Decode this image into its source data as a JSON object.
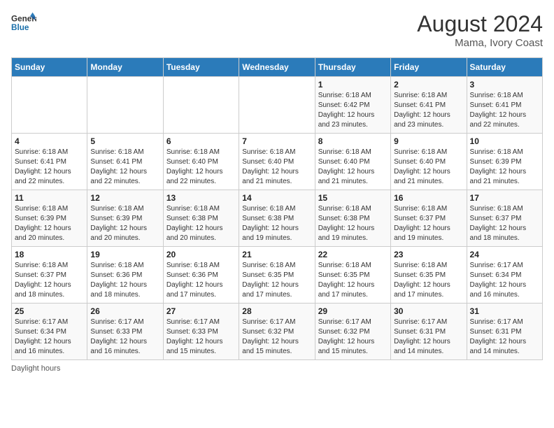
{
  "header": {
    "logo_general": "General",
    "logo_blue": "Blue",
    "month_year": "August 2024",
    "location": "Mama, Ivory Coast"
  },
  "days_of_week": [
    "Sunday",
    "Monday",
    "Tuesday",
    "Wednesday",
    "Thursday",
    "Friday",
    "Saturday"
  ],
  "weeks": [
    [
      {
        "day": "",
        "info": ""
      },
      {
        "day": "",
        "info": ""
      },
      {
        "day": "",
        "info": ""
      },
      {
        "day": "",
        "info": ""
      },
      {
        "day": "1",
        "info": "Sunrise: 6:18 AM\nSunset: 6:42 PM\nDaylight: 12 hours\nand 23 minutes."
      },
      {
        "day": "2",
        "info": "Sunrise: 6:18 AM\nSunset: 6:41 PM\nDaylight: 12 hours\nand 23 minutes."
      },
      {
        "day": "3",
        "info": "Sunrise: 6:18 AM\nSunset: 6:41 PM\nDaylight: 12 hours\nand 22 minutes."
      }
    ],
    [
      {
        "day": "4",
        "info": "Sunrise: 6:18 AM\nSunset: 6:41 PM\nDaylight: 12 hours\nand 22 minutes."
      },
      {
        "day": "5",
        "info": "Sunrise: 6:18 AM\nSunset: 6:41 PM\nDaylight: 12 hours\nand 22 minutes."
      },
      {
        "day": "6",
        "info": "Sunrise: 6:18 AM\nSunset: 6:40 PM\nDaylight: 12 hours\nand 22 minutes."
      },
      {
        "day": "7",
        "info": "Sunrise: 6:18 AM\nSunset: 6:40 PM\nDaylight: 12 hours\nand 21 minutes."
      },
      {
        "day": "8",
        "info": "Sunrise: 6:18 AM\nSunset: 6:40 PM\nDaylight: 12 hours\nand 21 minutes."
      },
      {
        "day": "9",
        "info": "Sunrise: 6:18 AM\nSunset: 6:40 PM\nDaylight: 12 hours\nand 21 minutes."
      },
      {
        "day": "10",
        "info": "Sunrise: 6:18 AM\nSunset: 6:39 PM\nDaylight: 12 hours\nand 21 minutes."
      }
    ],
    [
      {
        "day": "11",
        "info": "Sunrise: 6:18 AM\nSunset: 6:39 PM\nDaylight: 12 hours\nand 20 minutes."
      },
      {
        "day": "12",
        "info": "Sunrise: 6:18 AM\nSunset: 6:39 PM\nDaylight: 12 hours\nand 20 minutes."
      },
      {
        "day": "13",
        "info": "Sunrise: 6:18 AM\nSunset: 6:38 PM\nDaylight: 12 hours\nand 20 minutes."
      },
      {
        "day": "14",
        "info": "Sunrise: 6:18 AM\nSunset: 6:38 PM\nDaylight: 12 hours\nand 19 minutes."
      },
      {
        "day": "15",
        "info": "Sunrise: 6:18 AM\nSunset: 6:38 PM\nDaylight: 12 hours\nand 19 minutes."
      },
      {
        "day": "16",
        "info": "Sunrise: 6:18 AM\nSunset: 6:37 PM\nDaylight: 12 hours\nand 19 minutes."
      },
      {
        "day": "17",
        "info": "Sunrise: 6:18 AM\nSunset: 6:37 PM\nDaylight: 12 hours\nand 18 minutes."
      }
    ],
    [
      {
        "day": "18",
        "info": "Sunrise: 6:18 AM\nSunset: 6:37 PM\nDaylight: 12 hours\nand 18 minutes."
      },
      {
        "day": "19",
        "info": "Sunrise: 6:18 AM\nSunset: 6:36 PM\nDaylight: 12 hours\nand 18 minutes."
      },
      {
        "day": "20",
        "info": "Sunrise: 6:18 AM\nSunset: 6:36 PM\nDaylight: 12 hours\nand 17 minutes."
      },
      {
        "day": "21",
        "info": "Sunrise: 6:18 AM\nSunset: 6:35 PM\nDaylight: 12 hours\nand 17 minutes."
      },
      {
        "day": "22",
        "info": "Sunrise: 6:18 AM\nSunset: 6:35 PM\nDaylight: 12 hours\nand 17 minutes."
      },
      {
        "day": "23",
        "info": "Sunrise: 6:18 AM\nSunset: 6:35 PM\nDaylight: 12 hours\nand 17 minutes."
      },
      {
        "day": "24",
        "info": "Sunrise: 6:17 AM\nSunset: 6:34 PM\nDaylight: 12 hours\nand 16 minutes."
      }
    ],
    [
      {
        "day": "25",
        "info": "Sunrise: 6:17 AM\nSunset: 6:34 PM\nDaylight: 12 hours\nand 16 minutes."
      },
      {
        "day": "26",
        "info": "Sunrise: 6:17 AM\nSunset: 6:33 PM\nDaylight: 12 hours\nand 16 minutes."
      },
      {
        "day": "27",
        "info": "Sunrise: 6:17 AM\nSunset: 6:33 PM\nDaylight: 12 hours\nand 15 minutes."
      },
      {
        "day": "28",
        "info": "Sunrise: 6:17 AM\nSunset: 6:32 PM\nDaylight: 12 hours\nand 15 minutes."
      },
      {
        "day": "29",
        "info": "Sunrise: 6:17 AM\nSunset: 6:32 PM\nDaylight: 12 hours\nand 15 minutes."
      },
      {
        "day": "30",
        "info": "Sunrise: 6:17 AM\nSunset: 6:31 PM\nDaylight: 12 hours\nand 14 minutes."
      },
      {
        "day": "31",
        "info": "Sunrise: 6:17 AM\nSunset: 6:31 PM\nDaylight: 12 hours\nand 14 minutes."
      }
    ]
  ],
  "footer": {
    "note": "Daylight hours"
  }
}
